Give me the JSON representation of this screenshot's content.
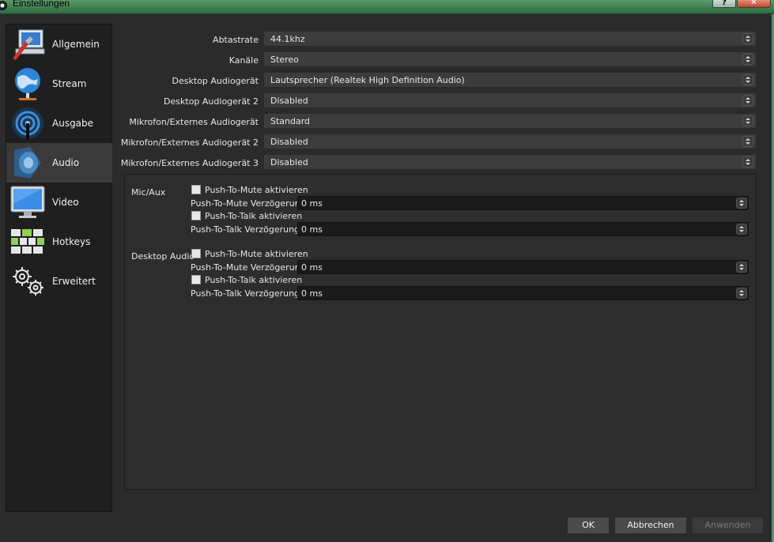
{
  "window": {
    "title": "Einstellungen",
    "help_label": "?",
    "close_label": "✕"
  },
  "sidebar": {
    "items": [
      {
        "label": "Allgemein",
        "icon": "general-settings-icon"
      },
      {
        "label": "Stream",
        "icon": "globe-stream-icon"
      },
      {
        "label": "Ausgabe",
        "icon": "broadcast-output-icon"
      },
      {
        "label": "Audio",
        "icon": "speaker-icon"
      },
      {
        "label": "Video",
        "icon": "monitor-icon"
      },
      {
        "label": "Hotkeys",
        "icon": "keyboard-icon"
      },
      {
        "label": "Erweitert",
        "icon": "gears-icon"
      }
    ],
    "active": "Audio"
  },
  "audio": {
    "rows": [
      {
        "label": "Abtastrate",
        "value": "44.1khz"
      },
      {
        "label": "Kanäle",
        "value": "Stereo"
      },
      {
        "label": "Desktop Audiogerät",
        "value": "Lautsprecher (Realtek High Definition Audio)"
      },
      {
        "label": "Desktop Audiogerät 2",
        "value": "Disabled"
      },
      {
        "label": "Mikrofon/Externes Audiogerät",
        "value": "Standard"
      },
      {
        "label": "Mikrofon/Externes Audiogerät 2",
        "value": "Disabled"
      },
      {
        "label": "Mikrofon/Externes Audiogerät 3",
        "value": "Disabled"
      }
    ],
    "groups": [
      {
        "title": "Mic/Aux",
        "push_to_mute_label": "Push-To-Mute aktivieren",
        "push_to_mute_delay_label": "Push-To-Mute Verzögerung",
        "push_to_mute_delay_value": "0 ms",
        "push_to_talk_label": "Push-To-Talk aktivieren",
        "push_to_talk_delay_label": "Push-To-Talk Verzögerung",
        "push_to_talk_delay_value": "0 ms"
      },
      {
        "title": "Desktop Audio",
        "push_to_mute_label": "Push-To-Mute aktivieren",
        "push_to_mute_delay_label": "Push-To-Mute Verzögerung",
        "push_to_mute_delay_value": "0 ms",
        "push_to_talk_label": "Push-To-Talk aktivieren",
        "push_to_talk_delay_label": "Push-To-Talk Verzögerung",
        "push_to_talk_delay_value": "0 ms"
      }
    ]
  },
  "buttons": {
    "ok": "OK",
    "cancel": "Abbrechen",
    "apply": "Anwenden"
  }
}
